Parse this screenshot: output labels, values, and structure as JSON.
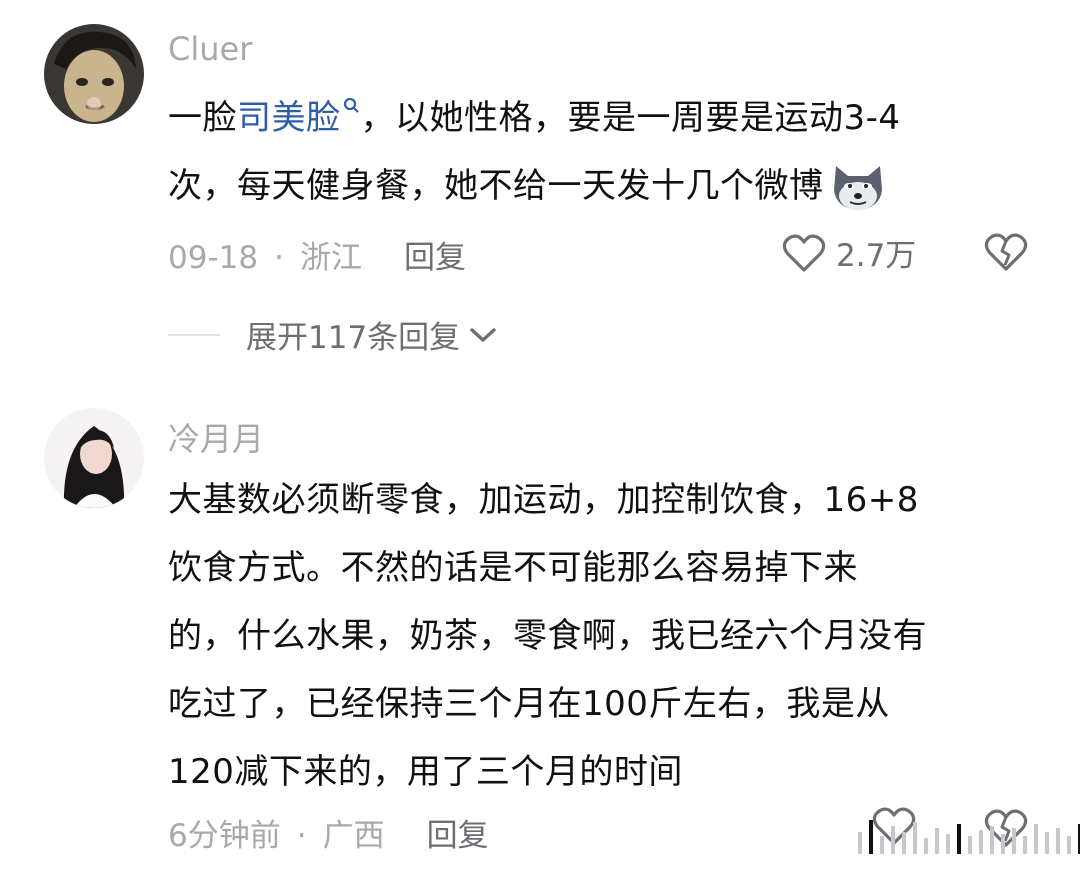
{
  "comments": [
    {
      "username": "Cluer",
      "lines": {
        "l1_prefix": "一脸",
        "l1_hashtag": "司美脸",
        "l1_suffix": "，以她性格，要是一周要是运动3-4",
        "l2": "次，每天健身餐，她不给一天发十几个微博"
      },
      "emoji_icon": "wolf-face-emoji",
      "time": "09-18",
      "location": "浙江",
      "reply_label": "回复",
      "like_count": "2.7万",
      "expand_label": "展开117条回复"
    },
    {
      "username": "冷月月",
      "lines": {
        "l1": "大基数必须断零食，加运动，加控制饮食，16+8",
        "l2": "饮食方式。不然的话是不可能那么容易掉下来",
        "l3": "的，什么水果，奶茶，零食啊，我已经六个月没有",
        "l4": "吃过了，已经保持三个月在100斤左右，我是从",
        "l5": "120减下来的，用了三个月的时间"
      },
      "time": "6分钟前",
      "location": "广西",
      "reply_label": "回复"
    }
  ],
  "separator": "·",
  "colors": {
    "hashtag": "#2f5ea8",
    "meta": "#a9a9ad",
    "text": "#111111"
  }
}
